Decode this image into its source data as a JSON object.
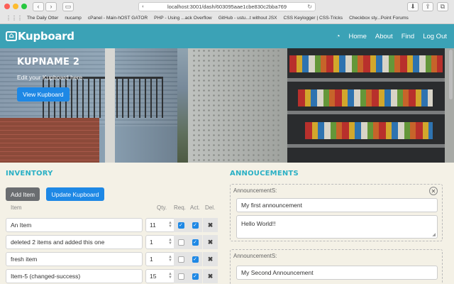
{
  "browser": {
    "url": "localhost:3001/dash/603095aae1cbe830c2bba769",
    "bookmarks": [
      "The Daily Otter",
      "nucamp",
      "cPanel - Main-hOST GATOR",
      "PHP - Using ...ack Overflow",
      "GitHub - ustu...t without JSX",
      "CSS Keylogger | CSS-Tricks",
      "Checkbox sty...Point Forums"
    ]
  },
  "navbar": {
    "logo": "Kupboard",
    "links": [
      "Home",
      "About",
      "Find",
      "Log Out"
    ]
  },
  "hero": {
    "title": "KUPNAME 2",
    "subtitle": "Edit your Kupboard here.",
    "button": "View Kupboard"
  },
  "inventory": {
    "title": "INVENTORY",
    "add_button": "Add Item",
    "update_button": "Update Kupboard",
    "columns": {
      "item": "Item",
      "qty": "Qty.",
      "req": "Req.",
      "act": "Act.",
      "del": "Del."
    },
    "rows": [
      {
        "name": "An Item",
        "qty": "11",
        "req": true,
        "act": true
      },
      {
        "name": "deleted 2 items and added this one",
        "qty": "1",
        "req": false,
        "act": true
      },
      {
        "name": "fresh item",
        "qty": "1",
        "req": false,
        "act": true
      },
      {
        "name": "Item-5 (changed-success)",
        "qty": "15",
        "req": false,
        "act": true
      }
    ]
  },
  "announcements": {
    "title": "ANNOUCEMENTS",
    "cards": [
      {
        "label": "AnnouncementS:",
        "title": "My first announcement",
        "body": "Hello World!!"
      },
      {
        "label": "AnnouncementS:",
        "title": "My Second Announcement",
        "body": ""
      }
    ]
  },
  "colors": {
    "navbar": "#3ba2b6",
    "accent": "#2ab0c5",
    "button_blue": "#1e88e5",
    "button_gray": "#6a6d70"
  }
}
